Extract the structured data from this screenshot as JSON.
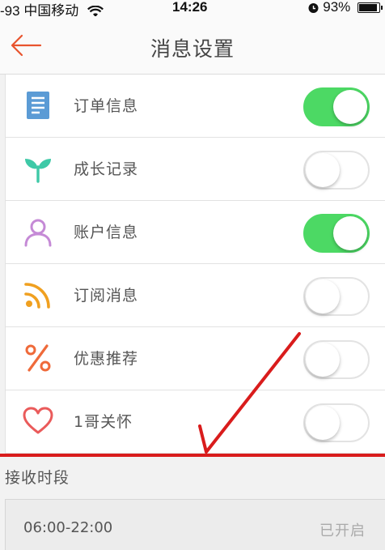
{
  "status_bar": {
    "signal": "-93",
    "carrier": "中国移动",
    "time": "14:26",
    "battery": "93%"
  },
  "navbar": {
    "title": "消息设置",
    "back_icon": "arrow-left-icon"
  },
  "settings": [
    {
      "label": "订单信息",
      "icon": "order-list-icon",
      "enabled": true,
      "color": "#5b9bd5"
    },
    {
      "label": "成长记录",
      "icon": "sprout-icon",
      "enabled": false,
      "color": "#3ec9a7"
    },
    {
      "label": "账户信息",
      "icon": "user-icon",
      "enabled": true,
      "color": "#c58ad6"
    },
    {
      "label": "订阅消息",
      "icon": "rss-icon",
      "enabled": false,
      "color": "#f0a020"
    },
    {
      "label": "优惠推荐",
      "icon": "percent-icon",
      "enabled": false,
      "color": "#ef6a3a"
    },
    {
      "label": "1哥关怀",
      "icon": "heart-icon",
      "enabled": false,
      "color": "#ea5b5b"
    }
  ],
  "period": {
    "section_title": "接收时段",
    "time_range": "06:00-22:00",
    "status": "已开启"
  },
  "colors": {
    "toggle_on": "#4cd964",
    "accent_back": "#e8542e",
    "annotation_red": "#d91c1c"
  }
}
